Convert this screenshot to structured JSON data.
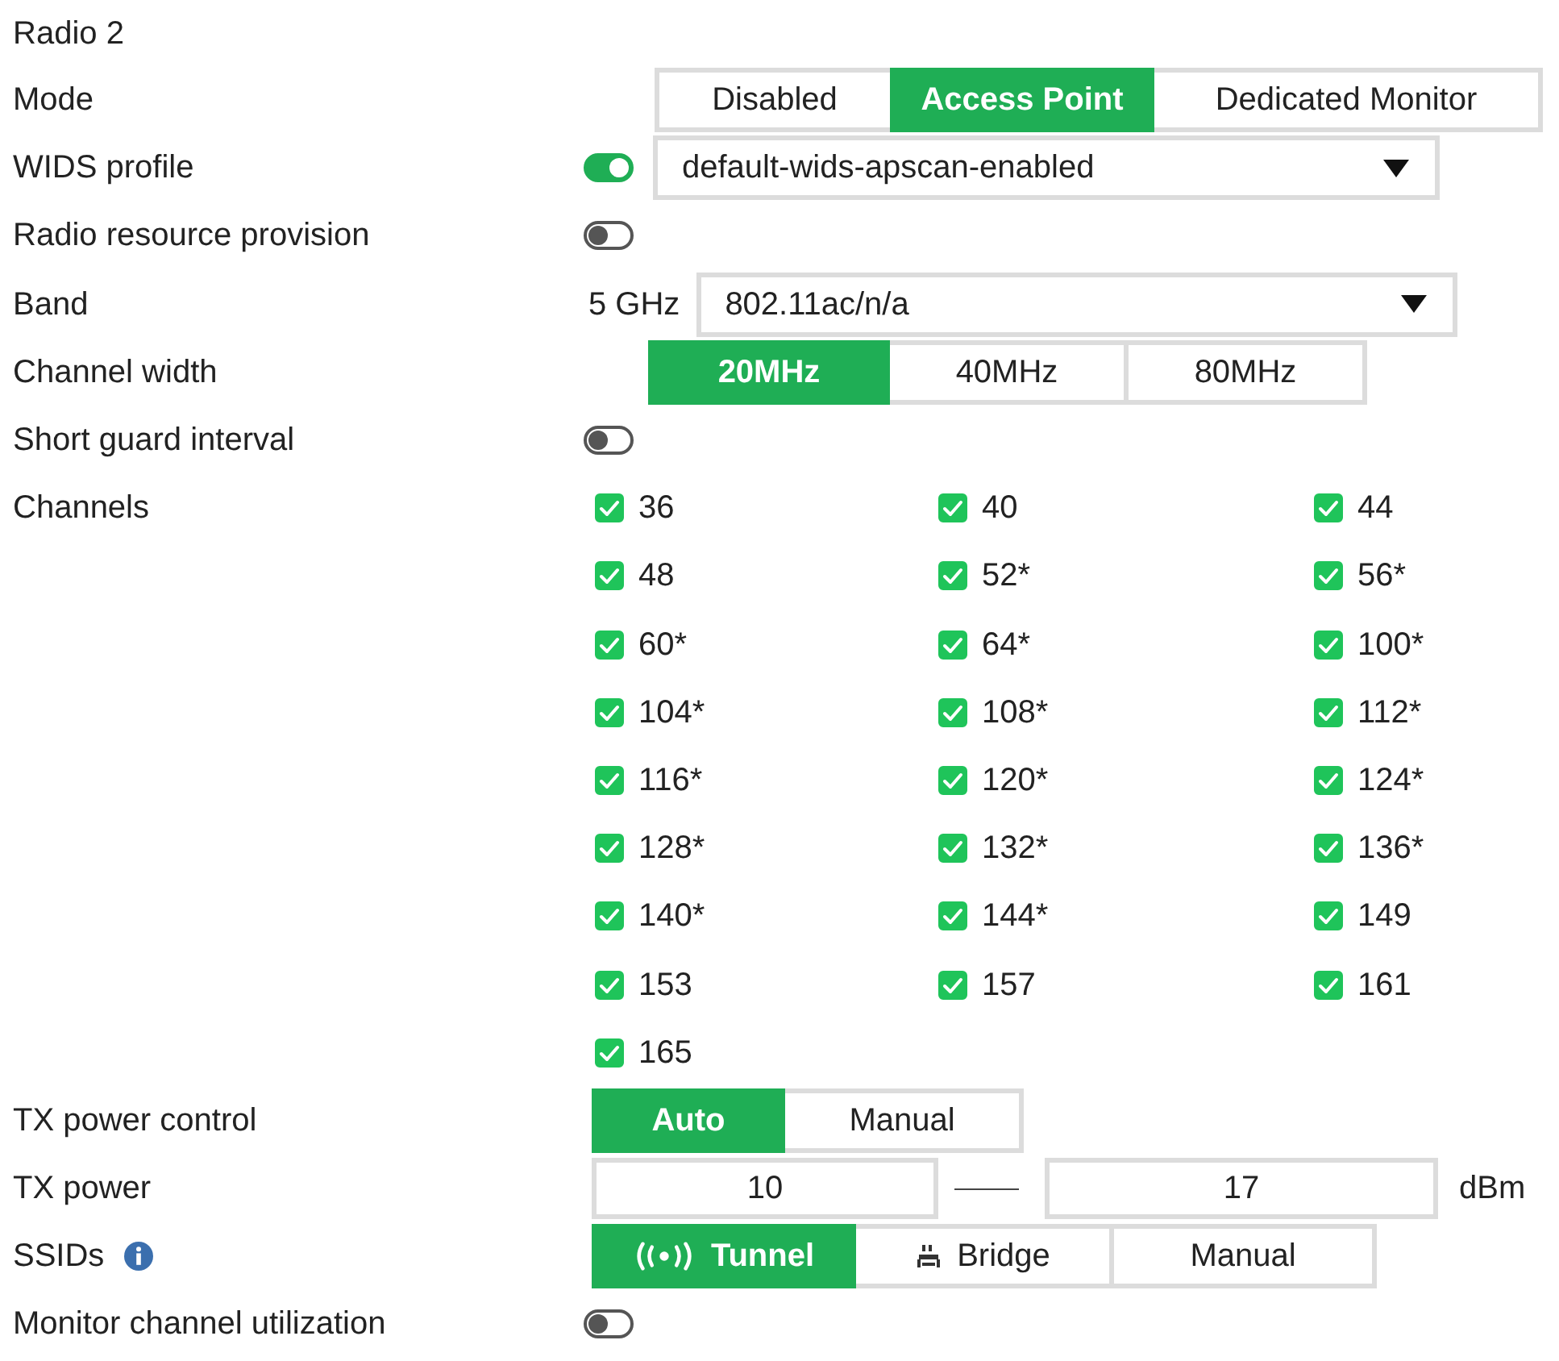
{
  "title": "Radio 2",
  "fields": [
    {
      "label": "Mode",
      "kind": "segmented",
      "options": [
        {
          "label": "Disabled",
          "selected": false
        },
        {
          "label": "Access Point",
          "selected": true
        },
        {
          "label": "Dedicated Monitor",
          "selected": false
        }
      ]
    },
    {
      "label": "WIDS profile",
      "kind": "toggle_select",
      "on": true,
      "value": "default-wids-apscan-enabled"
    },
    {
      "label": "Radio resource provision",
      "kind": "toggle",
      "on": false
    },
    {
      "label": "Band",
      "kind": "select",
      "prefix": "5 GHz",
      "value": "802.11ac/n/a"
    },
    {
      "label": "Channel width",
      "kind": "segmented",
      "options": [
        {
          "label": "20MHz",
          "selected": true
        },
        {
          "label": "40MHz",
          "selected": false
        },
        {
          "label": "80MHz",
          "selected": false
        }
      ]
    },
    {
      "label": "Short guard interval",
      "kind": "toggle",
      "on": false
    },
    {
      "label": "Channels",
      "kind": "checkboxes",
      "items": [
        {
          "label": "36",
          "checked": true
        },
        {
          "label": "40",
          "checked": true
        },
        {
          "label": "44",
          "checked": true
        },
        {
          "label": "48",
          "checked": true
        },
        {
          "label": "52*",
          "checked": true
        },
        {
          "label": "56*",
          "checked": true
        },
        {
          "label": "60*",
          "checked": true
        },
        {
          "label": "64*",
          "checked": true
        },
        {
          "label": "100*",
          "checked": true
        },
        {
          "label": "104*",
          "checked": true
        },
        {
          "label": "108*",
          "checked": true
        },
        {
          "label": "112*",
          "checked": true
        },
        {
          "label": "116*",
          "checked": true
        },
        {
          "label": "120*",
          "checked": true
        },
        {
          "label": "124*",
          "checked": true
        },
        {
          "label": "128*",
          "checked": true
        },
        {
          "label": "132*",
          "checked": true
        },
        {
          "label": "136*",
          "checked": true
        },
        {
          "label": "140*",
          "checked": true
        },
        {
          "label": "144*",
          "checked": true
        },
        {
          "label": "149",
          "checked": true
        },
        {
          "label": "153",
          "checked": true
        },
        {
          "label": "157",
          "checked": true
        },
        {
          "label": "161",
          "checked": true
        },
        {
          "label": "165",
          "checked": true
        }
      ]
    },
    {
      "label": "TX power control",
      "kind": "segmented",
      "options": [
        {
          "label": "Auto",
          "selected": true
        },
        {
          "label": "Manual",
          "selected": false
        }
      ]
    },
    {
      "label": "TX power",
      "kind": "range",
      "min": "10",
      "max": "17",
      "unit": "dBm"
    },
    {
      "label": "SSIDs",
      "kind": "segmented",
      "info": true,
      "options": [
        {
          "label": "Tunnel",
          "kind": "wireless",
          "selected": true
        },
        {
          "label": "Bridge",
          "kind": "device",
          "selected": false
        },
        {
          "label": "Manual",
          "kind": "plain",
          "selected": false
        }
      ]
    },
    {
      "label": "Monitor channel utilization",
      "kind": "toggle",
      "on": false
    }
  ]
}
